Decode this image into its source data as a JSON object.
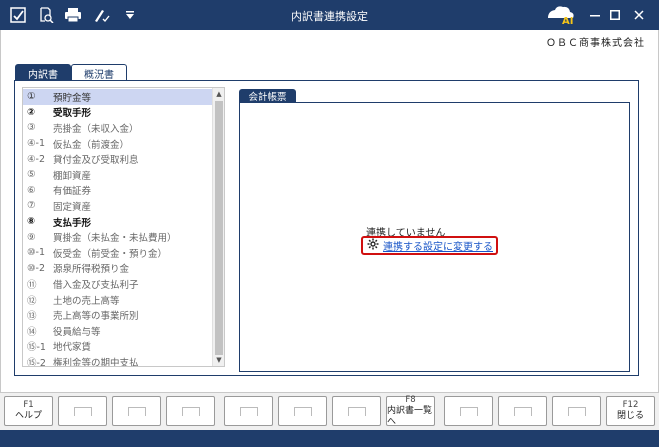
{
  "window": {
    "title": "内訳書連携設定",
    "company": "ＯＢＣ商事株式会社",
    "ai_badge": "AI"
  },
  "tabs": [
    {
      "label": "内訳書",
      "active": true
    },
    {
      "label": "概況書",
      "active": false
    }
  ],
  "list": {
    "items": [
      {
        "num": "①",
        "label": "預貯金等",
        "selected": true,
        "bold": false
      },
      {
        "num": "②",
        "label": "受取手形",
        "selected": false,
        "bold": true
      },
      {
        "num": "③",
        "label": "売掛金（未収入金）",
        "selected": false,
        "bold": false
      },
      {
        "num": "④-1",
        "label": "仮払金（前渡金）",
        "selected": false,
        "bold": false
      },
      {
        "num": "④-2",
        "label": "貸付金及び受取利息",
        "selected": false,
        "bold": false
      },
      {
        "num": "⑤",
        "label": "棚卸資産",
        "selected": false,
        "bold": false
      },
      {
        "num": "⑥",
        "label": "有価証券",
        "selected": false,
        "bold": false
      },
      {
        "num": "⑦",
        "label": "固定資産",
        "selected": false,
        "bold": false
      },
      {
        "num": "⑧",
        "label": "支払手形",
        "selected": false,
        "bold": true
      },
      {
        "num": "⑨",
        "label": "買掛金（未払金・未払費用）",
        "selected": false,
        "bold": false
      },
      {
        "num": "⑩-1",
        "label": "仮受金（前受金・預り金）",
        "selected": false,
        "bold": false
      },
      {
        "num": "⑩-2",
        "label": "源泉所得税預り金",
        "selected": false,
        "bold": false
      },
      {
        "num": "⑪",
        "label": "借入金及び支払利子",
        "selected": false,
        "bold": false
      },
      {
        "num": "⑫",
        "label": "土地の売上高等",
        "selected": false,
        "bold": false
      },
      {
        "num": "⑬",
        "label": "売上高等の事業所別",
        "selected": false,
        "bold": false
      },
      {
        "num": "⑭",
        "label": "役員給与等",
        "selected": false,
        "bold": false
      },
      {
        "num": "⑮-1",
        "label": "地代家賃",
        "selected": false,
        "bold": false
      },
      {
        "num": "⑮-2",
        "label": "権利金等の期中支払",
        "selected": false,
        "bold": false
      }
    ]
  },
  "panel": {
    "tab_label": "会計帳票",
    "status_text": "連携していません",
    "link_text": "連携する設定に変更する"
  },
  "fkeys": [
    {
      "key": "F1",
      "label": "ヘルプ"
    },
    {
      "key": "",
      "label": ""
    },
    {
      "key": "",
      "label": ""
    },
    {
      "key": "",
      "label": ""
    },
    {
      "key": "",
      "label": ""
    },
    {
      "key": "",
      "label": ""
    },
    {
      "key": "",
      "label": ""
    },
    {
      "key": "F8",
      "label": "内訳書一覧へ"
    },
    {
      "key": "",
      "label": ""
    },
    {
      "key": "",
      "label": ""
    },
    {
      "key": "",
      "label": ""
    },
    {
      "key": "F12",
      "label": "閉じる"
    }
  ],
  "colors": {
    "titlebar": "#1f3d6b",
    "selected_row": "#cdd6f2",
    "link": "#1a56c8",
    "highlight_border": "#d01010"
  },
  "icons": [
    "magnifier-page-icon",
    "printer-icon",
    "pen-check-icon",
    "dropdown-arrow-icon",
    "ai-assistant-icon",
    "minimize-icon",
    "maximize-icon",
    "close-icon",
    "gear-icon"
  ]
}
